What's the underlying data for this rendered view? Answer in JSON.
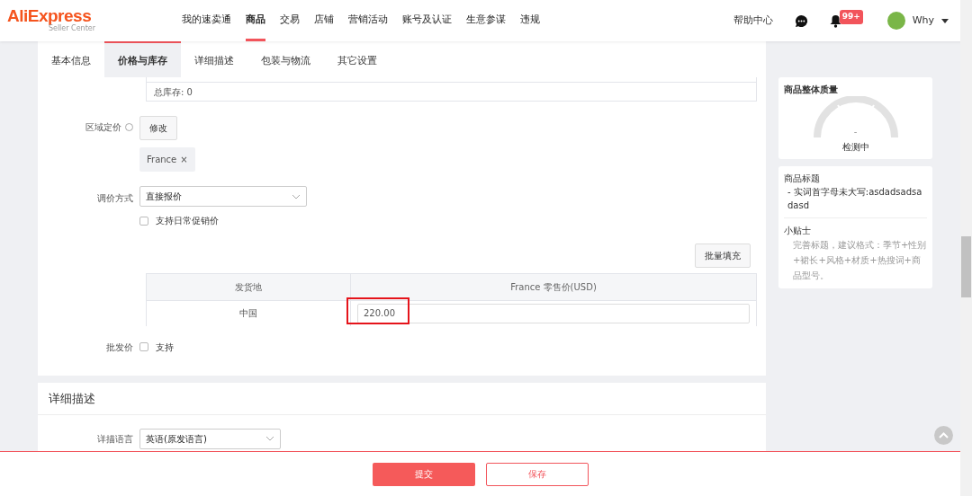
{
  "header": {
    "logo": "AliExpress",
    "logo_sub": "Seller Center",
    "nav": [
      {
        "label": "我的速卖通",
        "selected": false
      },
      {
        "label": "商品",
        "selected": true
      },
      {
        "label": "交易",
        "selected": false
      },
      {
        "label": "店铺",
        "selected": false
      },
      {
        "label": "营销活动",
        "selected": false
      },
      {
        "label": "账号及认证",
        "selected": false
      },
      {
        "label": "生意参谋",
        "selected": false
      },
      {
        "label": "违规",
        "selected": false
      }
    ],
    "help": "帮助中心",
    "notification_badge": "99+",
    "user": "Why"
  },
  "tabs": [
    {
      "label": "基本信息",
      "selected": false
    },
    {
      "label": "价格与库存",
      "selected": true
    },
    {
      "label": "详细描述",
      "selected": false
    },
    {
      "label": "包装与物流",
      "selected": false
    },
    {
      "label": "其它设置",
      "selected": false
    }
  ],
  "stock_total": "总库存: 0",
  "region_pricing": {
    "label": "区域定价",
    "button": "修改",
    "tags": [
      {
        "label": "France",
        "remove": "×"
      }
    ]
  },
  "pricing_method": {
    "label": "调价方式",
    "value": "直接报价",
    "promo_checkbox": {
      "label": "支持日常促销价",
      "checked": false
    }
  },
  "batch_fill": "批量填充",
  "price_table": {
    "columns": [
      "发货地",
      "France 零售价(USD)"
    ],
    "rows": [
      {
        "origin": "中国",
        "price": "220.00",
        "highlighted": true
      }
    ]
  },
  "wholesale": {
    "label": "批发价",
    "checkbox": {
      "label": "支持",
      "checked": false
    }
  },
  "detail_section": {
    "title": "详细描述",
    "language_label": "详描语言",
    "language_value": "英语(原发语言)"
  },
  "quality": {
    "title": "商品整体质量",
    "score": "-",
    "status": "检测中"
  },
  "tips_card": {
    "title": "商品标题",
    "issue": "- 实词首字母未大写:asdadsadsadasd",
    "tips_title": "小贴士",
    "tips_text": "完善标题，建议格式：季节+性别+裙长+风格+材质+热搜词+商品型号。"
  },
  "footer": {
    "submit": "提交",
    "save": "保存"
  }
}
